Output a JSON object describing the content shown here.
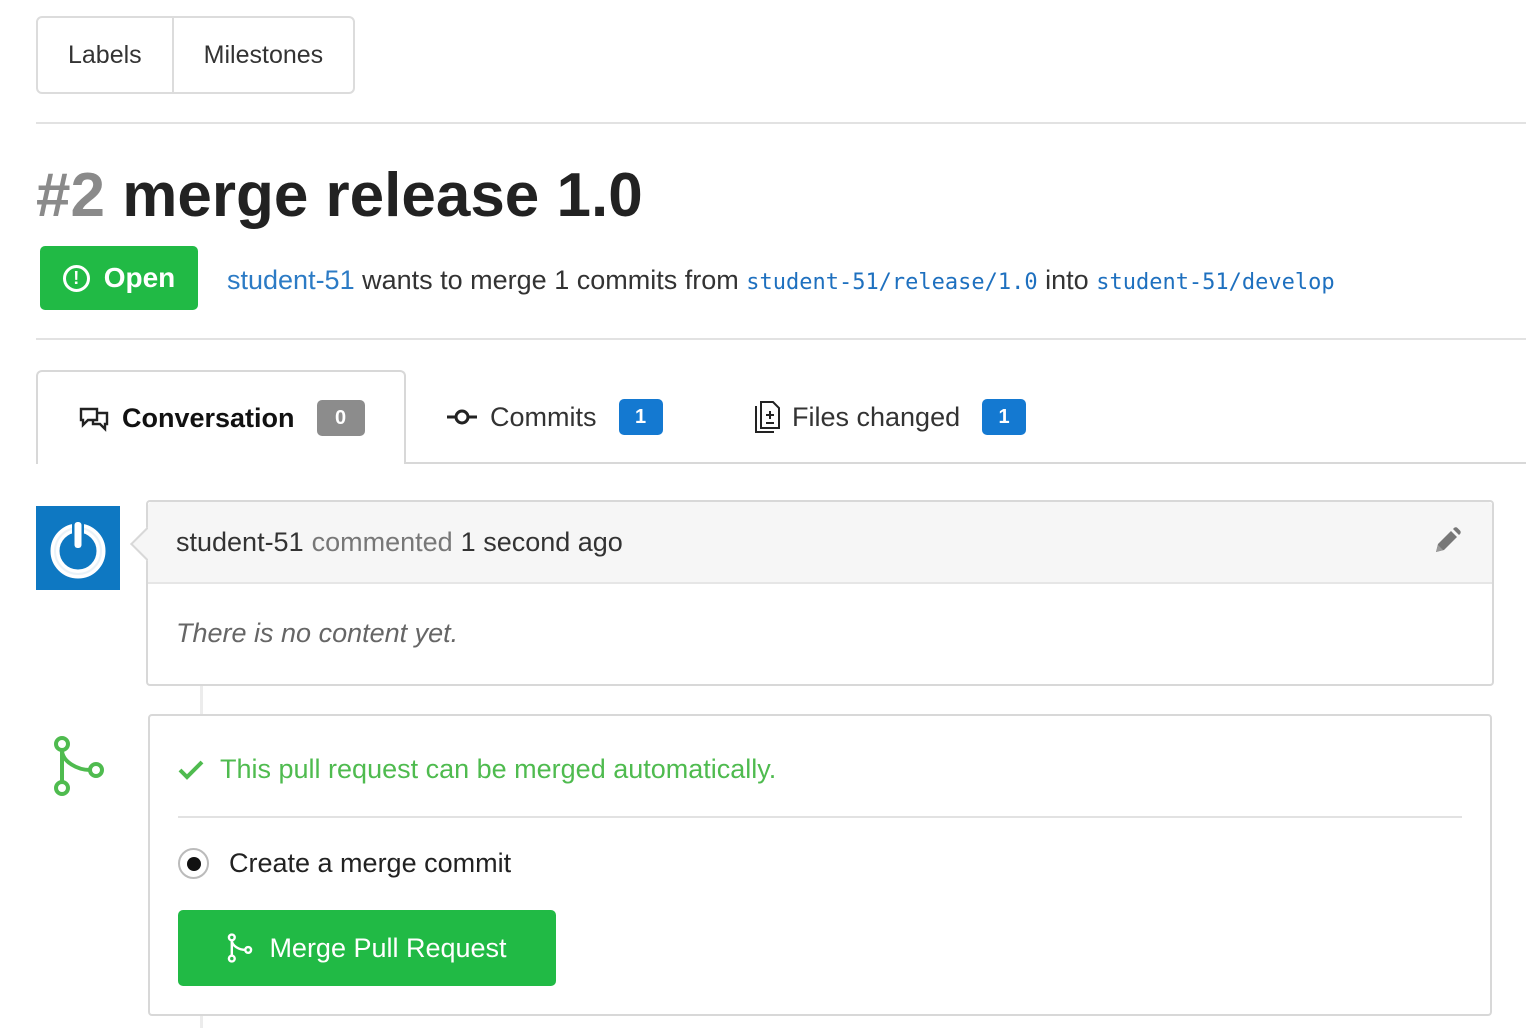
{
  "nav": {
    "labels": "Labels",
    "milestones": "Milestones"
  },
  "pr": {
    "number": "#2",
    "title": "merge release 1.0",
    "state": "Open",
    "author": "student-51",
    "merge_text_1": "wants to merge 1 commits from",
    "head_branch": "student-51/release/1.0",
    "merge_text_2": "into",
    "base_branch": "student-51/develop"
  },
  "tabs": {
    "conversation": {
      "label": "Conversation",
      "count": "0"
    },
    "commits": {
      "label": "Commits",
      "count": "1"
    },
    "files": {
      "label": "Files changed",
      "count": "1"
    }
  },
  "comment": {
    "author": "student-51",
    "verb": "commented",
    "time": "1 second ago",
    "body": "There is no content yet."
  },
  "merge": {
    "status": "This pull request can be merged automatically.",
    "style_option": "Create a merge commit",
    "button": "Merge Pull Request"
  },
  "colors": {
    "green": "#21ba45",
    "blue": "#1479d1",
    "link": "#2c7bc5"
  },
  "icons": [
    "alert-circle-icon",
    "conversation-icon",
    "commit-icon",
    "file-diff-icon",
    "pencil-icon",
    "merge-icon",
    "check-icon"
  ]
}
